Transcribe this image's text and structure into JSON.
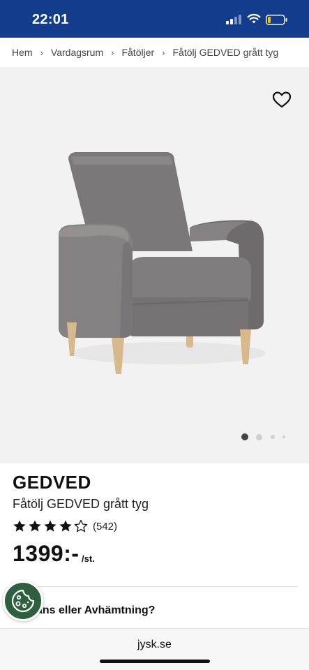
{
  "status_bar": {
    "time": "22:01",
    "bg_color": "#143c8c"
  },
  "breadcrumb": {
    "items": [
      {
        "label": "Hem"
      },
      {
        "label": "Vardagsrum"
      },
      {
        "label": "Fåtöljer"
      },
      {
        "label": "Fåtölj GEDVED grått tyg"
      }
    ],
    "separator_icon": "chevron-right-icon"
  },
  "gallery": {
    "favorite_icon": "heart-outline-icon",
    "image_subject": "grey fabric armchair with wooden legs",
    "page_count": 4,
    "active_index": 0
  },
  "product": {
    "brand": "GEDVED",
    "name": "Fåtölj GEDVED grått tyg",
    "rating": {
      "stars": 4,
      "max": 5,
      "count_label": "(542)"
    },
    "price": "1399:-",
    "unit": "/st."
  },
  "delivery": {
    "label": "Frans eller Avhämtning?"
  },
  "cookie_button": {
    "icon": "cookie-icon",
    "color": "#2e5f3e"
  },
  "browser": {
    "url": "jysk.se"
  }
}
